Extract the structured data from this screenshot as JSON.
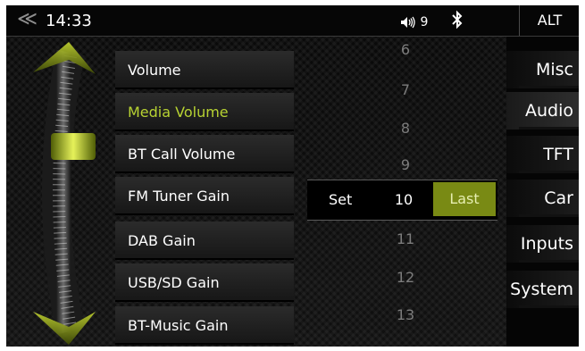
{
  "status": {
    "back_icon": "≪",
    "time": "14:33",
    "volume_value": "9",
    "alt_label": "ALT"
  },
  "menu": {
    "items": [
      {
        "label": "Volume"
      },
      {
        "label": "Media Volume"
      },
      {
        "label": "BT Call Volume"
      },
      {
        "label": "FM Tuner Gain"
      },
      {
        "label": "DAB Gain"
      },
      {
        "label": "USB/SD Gain"
      },
      {
        "label": "BT-Music Gain"
      }
    ],
    "active_index": 1
  },
  "picker": {
    "values_above": [
      "6",
      "7",
      "8",
      "9"
    ],
    "set_label": "Set",
    "selected": "10",
    "last_label": "Last",
    "values_below": [
      "11",
      "12",
      "13"
    ]
  },
  "tabs": [
    {
      "label": "Misc"
    },
    {
      "label": "Audio"
    },
    {
      "label": "TFT"
    },
    {
      "label": "Car"
    },
    {
      "label": "Inputs"
    },
    {
      "label": "System"
    }
  ],
  "colors": {
    "accent": "#b7d232",
    "last_button_bg": "#798a14"
  }
}
